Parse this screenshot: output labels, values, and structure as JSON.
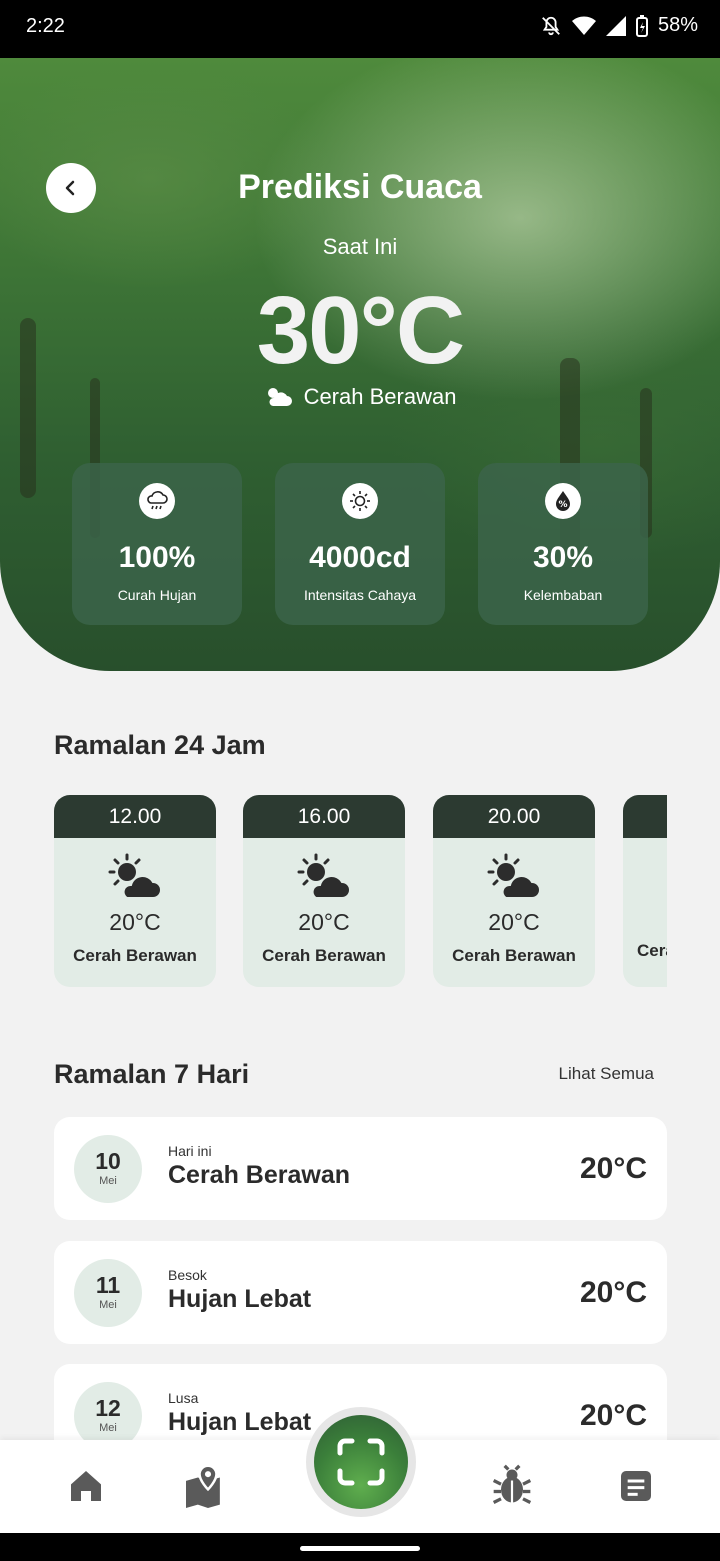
{
  "status_bar": {
    "time": "2:22",
    "battery": "58%"
  },
  "header": {
    "title": "Prediksi Cuaca",
    "subtitle": "Saat Ini",
    "temperature": "30°C",
    "condition": "Cerah Berawan"
  },
  "stats": [
    {
      "value": "100%",
      "label": "Curah Hujan",
      "icon": "rain-cloud-icon"
    },
    {
      "value": "4000cd",
      "label": "Intensitas Cahaya",
      "icon": "sun-icon"
    },
    {
      "value": "30%",
      "label": "Kelembaban",
      "icon": "humidity-drop-icon"
    }
  ],
  "hourly": {
    "title": "Ramalan 24 Jam",
    "items": [
      {
        "time": "12.00",
        "temp": "20°C",
        "condition": "Cerah Berawan"
      },
      {
        "time": "16.00",
        "temp": "20°C",
        "condition": "Cerah Berawan"
      },
      {
        "time": "20.00",
        "temp": "20°C",
        "condition": "Cerah Berawan"
      },
      {
        "time": "",
        "temp": "",
        "condition": "Cerah Berawan"
      }
    ]
  },
  "daily": {
    "title": "Ramalan 7 Hari",
    "see_all": "Lihat Semua",
    "items": [
      {
        "day": "10",
        "month": "Mei",
        "relative": "Hari ini",
        "condition": "Cerah Berawan",
        "temp": "20°C"
      },
      {
        "day": "11",
        "month": "Mei",
        "relative": "Besok",
        "condition": "Hujan Lebat",
        "temp": "20°C"
      },
      {
        "day": "12",
        "month": "Mei",
        "relative": "Lusa",
        "condition": "Hujan Lebat",
        "temp": "20°C"
      }
    ]
  },
  "bottom_nav": [
    "home-icon",
    "map-icon",
    "scan-icon",
    "bug-icon",
    "document-icon"
  ],
  "colors": {
    "accent_dark": "#2c3a31",
    "accent_green": "#3b7f3a",
    "card_tint": "#e2ece6"
  }
}
